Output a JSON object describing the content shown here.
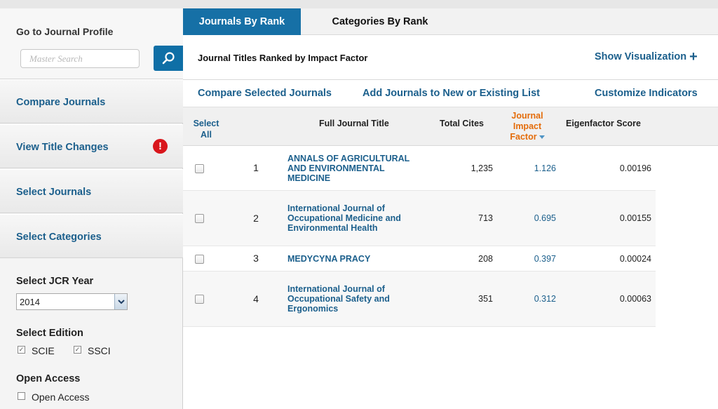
{
  "sidebar": {
    "search_title": "Go to Journal Profile",
    "search_placeholder": "Master Search",
    "nav": [
      {
        "label": "Compare Journals"
      },
      {
        "label": "View Title Changes",
        "alert": "!"
      },
      {
        "label": "Select Journals"
      },
      {
        "label": "Select Categories"
      }
    ],
    "jcr_year": {
      "title": "Select JCR Year",
      "value": "2014"
    },
    "edition": {
      "title": "Select Edition",
      "options": [
        {
          "label": "SCIE",
          "checked": true
        },
        {
          "label": "SSCI",
          "checked": true
        }
      ]
    },
    "open_access": {
      "title": "Open Access",
      "option": {
        "label": "Open Access",
        "checked": false
      }
    }
  },
  "tabs": [
    {
      "label": "Journals By Rank",
      "active": true
    },
    {
      "label": "Categories By Rank",
      "active": false
    }
  ],
  "main": {
    "ranked_title": "Journal Titles Ranked by Impact Factor",
    "show_visualization": "Show Visualization",
    "actions": [
      "Compare Selected Journals",
      "Add Journals to New or Existing List",
      "Customize Indicators"
    ]
  },
  "table": {
    "headers": {
      "select_all": [
        "Select",
        "All"
      ],
      "full_title": "Full Journal Title",
      "total_cites": "Total Cites",
      "jif": [
        "Journal",
        "Impact",
        "Factor"
      ],
      "eigenfactor": "Eigenfactor Score"
    },
    "rows": [
      {
        "rank": "1",
        "title": "ANNALS OF AGRICULTURAL AND ENVIRONMENTAL MEDICINE",
        "cites": "1,235",
        "jif": "1.126",
        "eigen": "0.00196"
      },
      {
        "rank": "2",
        "title": "International Journal of Occupational Medicine and Environmental Health",
        "cites": "713",
        "jif": "0.695",
        "eigen": "0.00155"
      },
      {
        "rank": "3",
        "title": "MEDYCYNA PRACY",
        "cites": "208",
        "jif": "0.397",
        "eigen": "0.00024"
      },
      {
        "rank": "4",
        "title": "International Journal of Occupational Safety and Ergonomics",
        "cites": "351",
        "jif": "0.312",
        "eigen": "0.00063"
      }
    ]
  },
  "colors": {
    "accent": "#1670a6",
    "link": "#1b5f8c",
    "sort_header": "#e46c0a",
    "alert": "#d9161c"
  }
}
